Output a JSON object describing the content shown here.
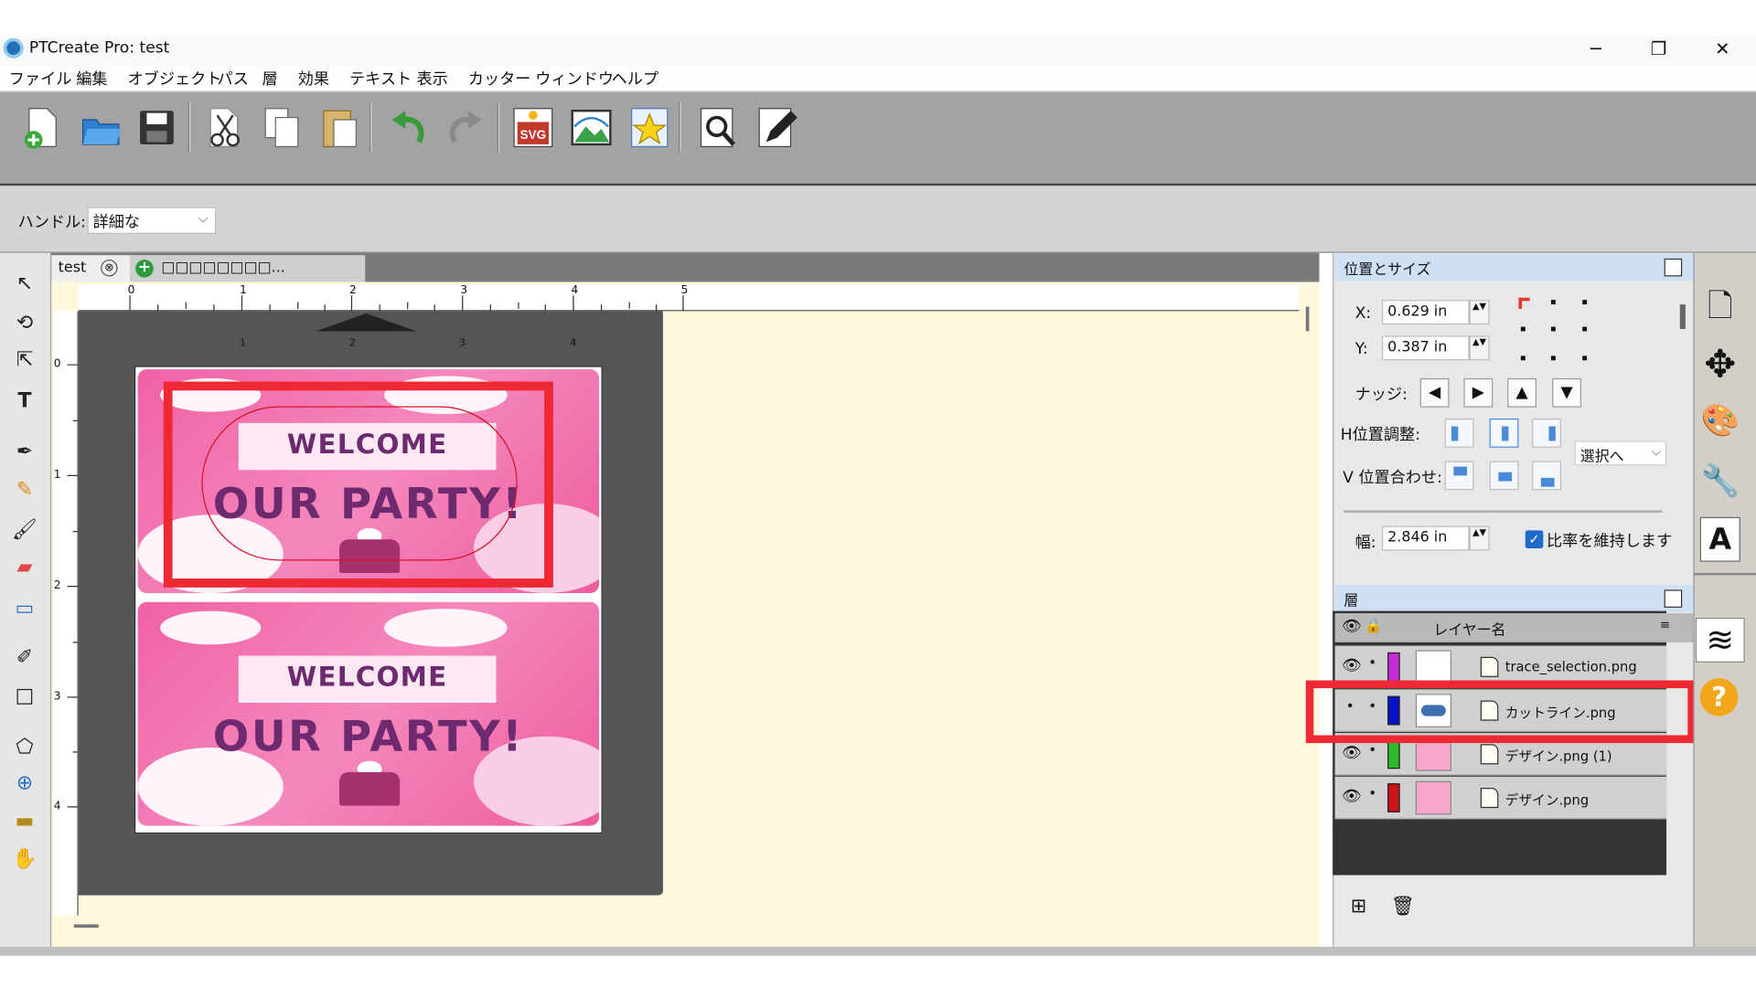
{
  "window": {
    "title": "PTCreate Pro: test",
    "minimize_glyph": "─",
    "restore_glyph": "❐",
    "close_glyph": "✕"
  },
  "menu": [
    "ファイル",
    "編集",
    "オブジェクト",
    "パス",
    "層",
    "効果",
    "テキスト",
    "表示",
    "カッター",
    "ウィンドウ",
    "ヘルプ"
  ],
  "toolbar": {
    "icons": [
      "new-document-icon",
      "open-icon",
      "save-icon",
      "cut-icon",
      "copy-icon",
      "paste-icon",
      "undo-icon",
      "redo-icon",
      "import-svg-icon",
      "import-image-icon",
      "favorite-icon",
      "preview-icon",
      "edit-pen-icon"
    ],
    "svg_label": "SVG"
  },
  "options": {
    "handle_label": "ハンドル:",
    "handle_value": "詳細な"
  },
  "tabs": {
    "active": "test",
    "close_glyph": "⊗",
    "new_label": "□□□□□□□□...",
    "new_glyph": "+"
  },
  "tools": {
    "glyphs": [
      "↖",
      "⟲",
      "⇱",
      "T",
      "✒",
      "✎",
      "🖌",
      "▰",
      "▭",
      "✐",
      "□",
      "⬠",
      "⊕",
      "▬",
      "✋"
    ],
    "names": [
      "select-tool-icon",
      "lasso-tool-icon",
      "node-select-tool-icon",
      "text-tool-icon",
      "pen-tool-icon",
      "pencil-tool-icon",
      "brush-tool-icon",
      "eraser-tool-icon",
      "rectangle-fill-tool-icon",
      "eyedropper-tool-icon",
      "rectangle-tool-icon",
      "polygon-tool-icon",
      "zoom-tool-icon",
      "ruler-tool-icon",
      "hand-tool-icon"
    ]
  },
  "rulers": {
    "top": [
      "0",
      "1",
      "2",
      "3",
      "4",
      "5"
    ],
    "mat_top": [
      "1",
      "2",
      "3",
      "4"
    ],
    "left": [
      "0",
      "1",
      "2",
      "3",
      "4"
    ]
  },
  "design": {
    "line1": "WELCOME",
    "line2": "OUR PARTY!",
    "bg_color": "#f06aa8",
    "text_color": "#6d2a6f"
  },
  "position_size": {
    "title": "位置とサイズ",
    "x_label": "X:",
    "x_value": "0.629 in",
    "y_label": "Y:",
    "y_value": "0.387 in",
    "nudge_label": "ナッジ:",
    "nudge": [
      "◀",
      "▶",
      "▲",
      "▼"
    ],
    "h_align_label": "H位置調整:",
    "v_align_label": "V 位置合わせ:",
    "align_target": "選択へ",
    "width_label": "幅:",
    "width_value": "2.846 in",
    "keep_ratio_label": "比率を維持します",
    "keep_ratio_checked": true,
    "spin_glyph": "▲▼"
  },
  "layers": {
    "title": "層",
    "column_header": "レイヤー名",
    "rows": [
      {
        "name": "trace_selection.png",
        "color": "#c62dd6",
        "visible": true
      },
      {
        "name": "カットライン.png",
        "color": "#0a12c8",
        "visible": false
      },
      {
        "name": "デザイン.png (1)",
        "color": "#2dbb2d",
        "visible": true
      },
      {
        "name": "デザイン.png",
        "color": "#c8151a",
        "visible": true
      }
    ],
    "eye_glyph": "👁",
    "dot_glyph": "•",
    "add_glyph": "⊞",
    "delete_glyph": "🗑"
  },
  "sidebar": {
    "glyphs": [
      "🗋",
      "✥",
      "🎨",
      "🔧",
      "A",
      "≋",
      "?"
    ],
    "names": [
      "document-icon",
      "move-icon",
      "palette-icon",
      "wrench-icon",
      "font-size-icon",
      "layers-icon",
      "help-icon"
    ]
  },
  "colors": {
    "highlight_red": "#ee2933",
    "canvas_cream": "#fff8dc",
    "panel_blue": "#cfe0f5"
  }
}
